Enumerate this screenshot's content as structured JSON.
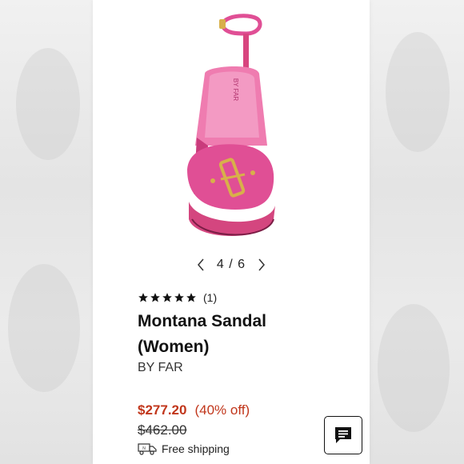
{
  "product": {
    "image_alt": "Pink leather ankle-strap sandal with gold buckle",
    "carousel": {
      "counter": "4 / 6",
      "current": 4,
      "total": 6
    },
    "rating": {
      "stars": 5,
      "max": 5,
      "review_count": "(1)"
    },
    "title": "Montana Sandal (Women)",
    "brand": "BY FAR",
    "insole_logo": "BY FAR",
    "price": "$277.20",
    "discount": "(40% off)",
    "original_price": "$462.00",
    "shipping": "Free shipping"
  },
  "colors": {
    "sandal_pink": "#e04f95",
    "price_red": "#c1361b",
    "buckle_gold": "#d8b04a"
  },
  "icons": {
    "prev": "chevron-left-icon",
    "next": "chevron-right-icon",
    "star": "star-icon",
    "truck": "truck-icon",
    "chat": "chat-icon"
  }
}
